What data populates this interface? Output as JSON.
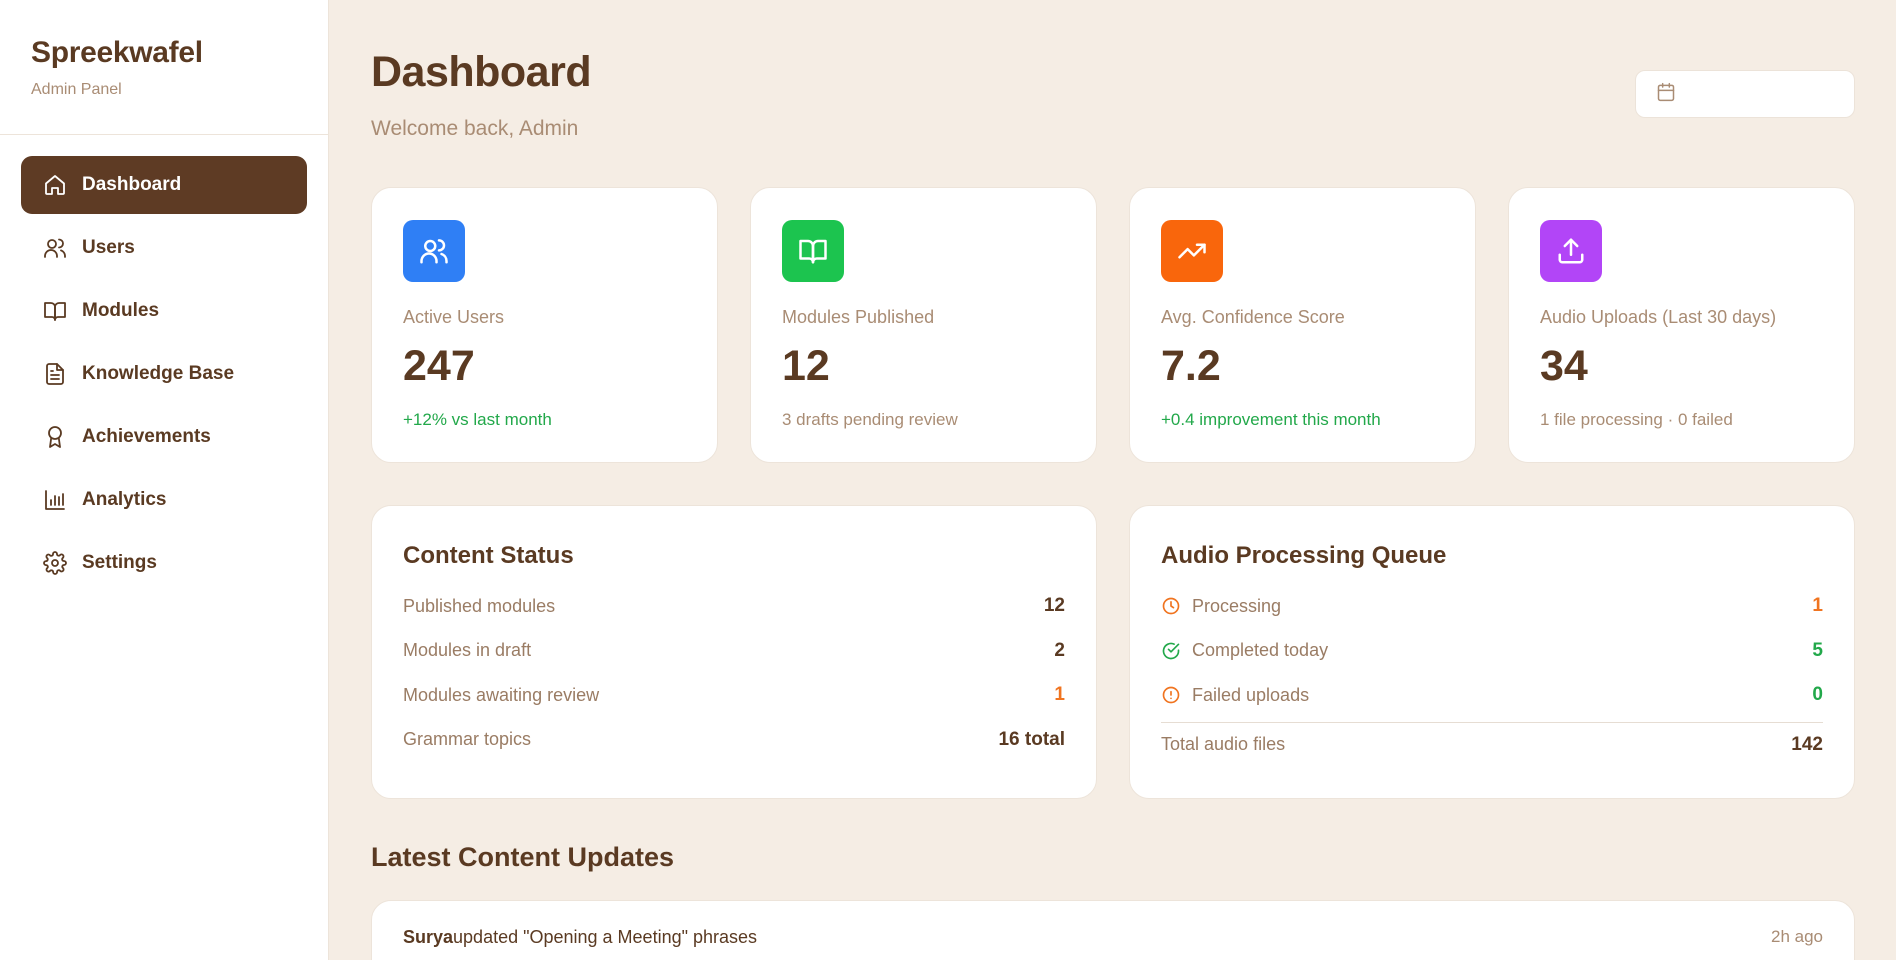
{
  "sidebar": {
    "brand": "Spreekwafel",
    "subtitle": "Admin Panel",
    "items": [
      {
        "label": "Dashboard",
        "icon": "home-icon",
        "active": true
      },
      {
        "label": "Users",
        "icon": "users-icon"
      },
      {
        "label": "Modules",
        "icon": "book-icon"
      },
      {
        "label": "Knowledge Base",
        "icon": "file-text-icon"
      },
      {
        "label": "Achievements",
        "icon": "award-icon"
      },
      {
        "label": "Analytics",
        "icon": "bar-chart-icon"
      },
      {
        "label": "Settings",
        "icon": "gear-icon"
      }
    ]
  },
  "header": {
    "title": "Dashboard",
    "subtitle": "Welcome back, Admin",
    "date_icon": "calendar-icon"
  },
  "stats": [
    {
      "label": "Active Users",
      "value": "247",
      "note": "+12% vs last month",
      "icon": "users-icon",
      "color": "#2f7ff5"
    },
    {
      "label": "Modules Published",
      "value": "12",
      "note": "3 drafts pending review",
      "icon": "book-icon",
      "color": "#1cc44f"
    },
    {
      "label": "Avg. Confidence Score",
      "value": "7.2",
      "note": "+0.4 improvement this month",
      "icon": "trending-up-icon",
      "color": "#f9660c"
    },
    {
      "label": "Audio Uploads (Last 30 days)",
      "value": "34",
      "note": "1 file processing · 0 failed",
      "icon": "upload-icon",
      "color": "#b245f7"
    }
  ],
  "content_status": {
    "title": "Content Status",
    "rows": [
      {
        "label": "Published modules",
        "value": "12"
      },
      {
        "label": "Modules in draft",
        "value": "2"
      },
      {
        "label": "Modules awaiting review",
        "value": "1"
      },
      {
        "label": "Grammar topics",
        "value": "16 total"
      }
    ]
  },
  "audio_queue": {
    "title": "Audio Processing Queue",
    "rows": [
      {
        "label": "Processing",
        "value": "1",
        "icon": "clock-icon"
      },
      {
        "label": "Completed today",
        "value": "5",
        "icon": "check-circle-icon"
      },
      {
        "label": "Failed uploads",
        "value": "0",
        "icon": "alert-circle-icon"
      }
    ],
    "total_label": "Total audio files",
    "total_value": "142"
  },
  "updates": {
    "title": "Latest Content Updates",
    "items": [
      {
        "user": "Surya",
        "text": "updated \"Opening a Meeting\" phrases",
        "time": "2h ago"
      }
    ]
  },
  "colors": {
    "brown": "#5e3b24",
    "accent_green": "#22a84a",
    "accent_orange": "#f07420",
    "background": "#f5ede4"
  }
}
